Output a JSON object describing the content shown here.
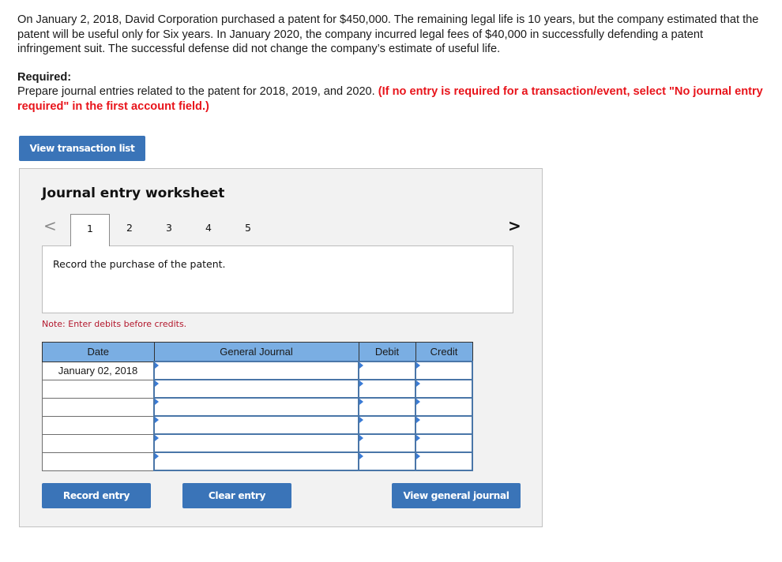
{
  "problem": {
    "paragraph": "On January 2, 2018, David Corporation purchased a patent for $450,000. The remaining legal life is 10 years, but the company estimated that the patent will be useful only for Six years. In January 2020, the company incurred legal fees of $40,000 in successfully defending a patent infringement suit. The successful defense did not change the company’s estimate of useful life."
  },
  "required": {
    "label": "Required:",
    "text": "Prepare journal entries related to the patent for 2018, 2019, and 2020. ",
    "instruction": "(If no entry is required for a transaction/event, select \"No journal entry required\" in the first account field.)"
  },
  "buttons": {
    "view_transaction_list": "View transaction list",
    "record_entry": "Record entry",
    "clear_entry": "Clear entry",
    "view_general_journal": "View general journal"
  },
  "worksheet": {
    "title": "Journal entry worksheet",
    "prev_icon": "<",
    "next_icon": ">",
    "tabs": [
      "1",
      "2",
      "3",
      "4",
      "5"
    ],
    "active_tab": "1",
    "instruction": "Record the purchase of the patent.",
    "note": "Note: Enter debits before credits.",
    "table": {
      "headers": [
        "Date",
        "General Journal",
        "Debit",
        "Credit"
      ],
      "rows": [
        {
          "date": "January 02, 2018",
          "account": "",
          "debit": "",
          "credit": ""
        },
        {
          "date": "",
          "account": "",
          "debit": "",
          "credit": ""
        },
        {
          "date": "",
          "account": "",
          "debit": "",
          "credit": ""
        },
        {
          "date": "",
          "account": "",
          "debit": "",
          "credit": ""
        },
        {
          "date": "",
          "account": "",
          "debit": "",
          "credit": ""
        },
        {
          "date": "",
          "account": "",
          "debit": "",
          "credit": ""
        }
      ]
    }
  }
}
